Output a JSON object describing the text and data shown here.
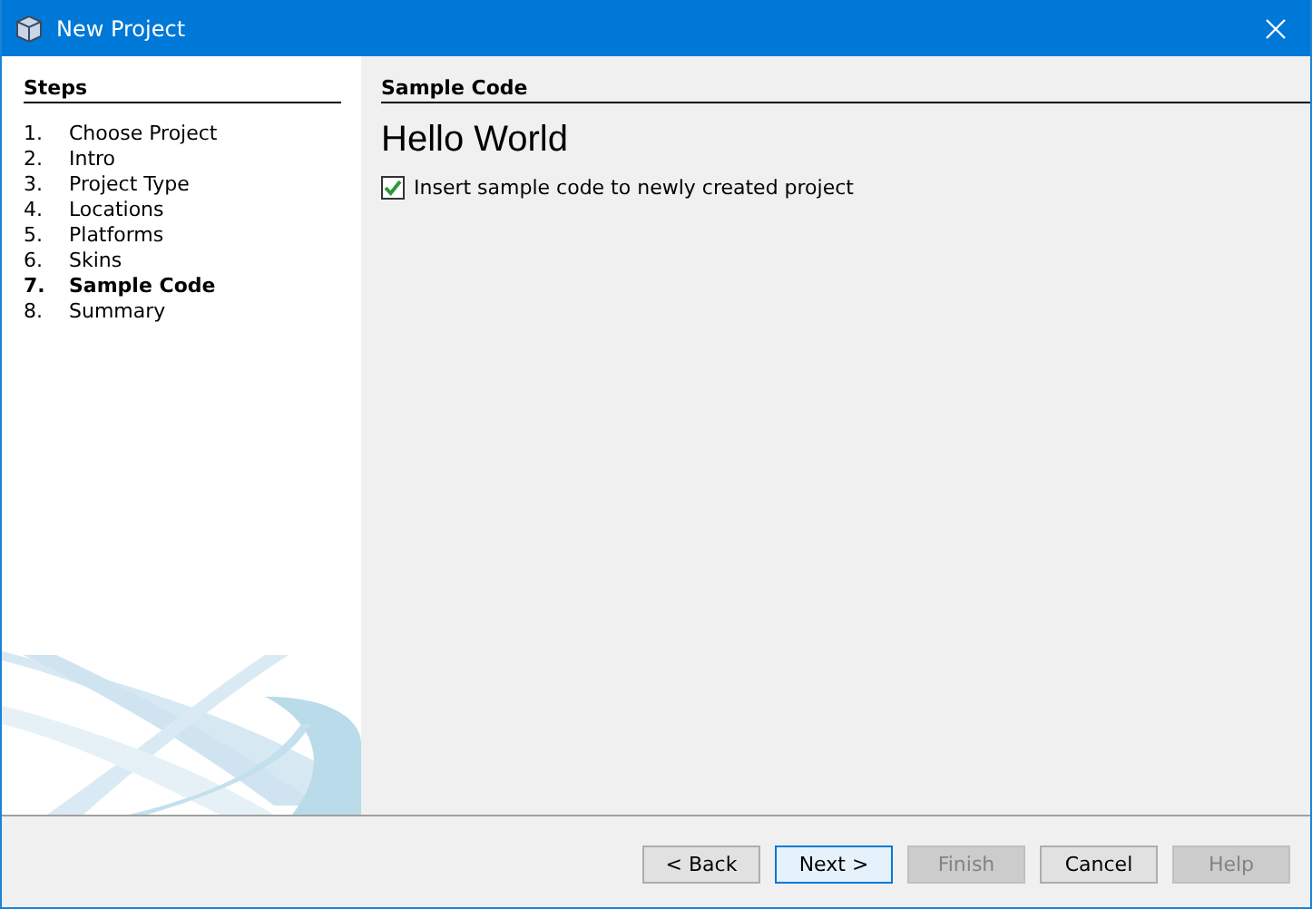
{
  "window": {
    "title": "New Project"
  },
  "steps": {
    "heading": "Steps",
    "items": [
      {
        "number": "1.",
        "label": "Choose Project",
        "selected": false
      },
      {
        "number": "2.",
        "label": "Intro",
        "selected": false
      },
      {
        "number": "3.",
        "label": "Project Type",
        "selected": false
      },
      {
        "number": "4.",
        "label": "Locations",
        "selected": false
      },
      {
        "number": "5.",
        "label": "Platforms",
        "selected": false
      },
      {
        "number": "6.",
        "label": "Skins",
        "selected": false
      },
      {
        "number": "7.",
        "label": "Sample Code",
        "selected": true
      },
      {
        "number": "8.",
        "label": "Summary",
        "selected": false
      }
    ]
  },
  "panel": {
    "heading": "Sample Code",
    "title": "Hello World",
    "checkbox": {
      "label": "Insert sample code to newly created project",
      "checked": true
    }
  },
  "buttons": [
    {
      "label": "< Back",
      "disabled": false,
      "focused": false
    },
    {
      "label": "Next >",
      "disabled": false,
      "focused": true
    },
    {
      "label": "Finish",
      "disabled": true,
      "focused": false
    },
    {
      "label": "Cancel",
      "disabled": false,
      "focused": false
    },
    {
      "label": "Help",
      "disabled": true,
      "focused": false
    }
  ]
}
